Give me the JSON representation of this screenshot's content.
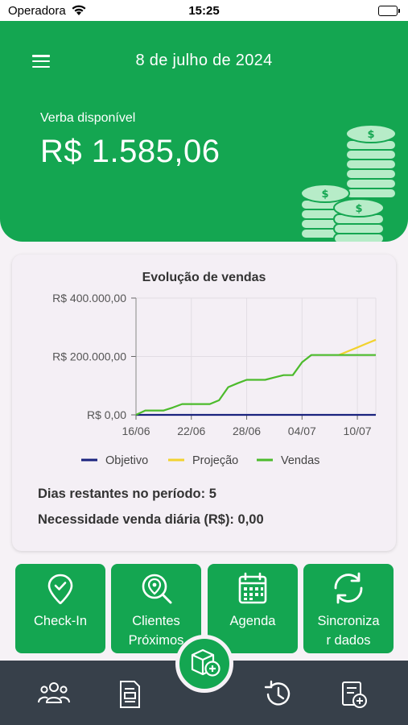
{
  "status_bar": {
    "carrier": "Operadora",
    "time": "15:25"
  },
  "header": {
    "date": "8 de julho de 2024",
    "budget_label": "Verba disponível",
    "budget_value": "R$ 1.585,06"
  },
  "card": {
    "chart_title": "Evolução de vendas",
    "stats": {
      "remaining_days": "Dias restantes no período: 5",
      "daily_need": "Necessidade venda diária (R$): 0,00"
    }
  },
  "chart_data": {
    "type": "line",
    "title": "Evolução de vendas",
    "x_ticks": [
      "16/06",
      "22/06",
      "28/06",
      "04/07",
      "10/07"
    ],
    "y_ticks": [
      "R$ 0,00",
      "R$ 200.000,00",
      "R$ 400.000,00"
    ],
    "ylim": [
      0,
      400000
    ],
    "x_days": [
      "16/06",
      "17/06",
      "18/06",
      "19/06",
      "20/06",
      "21/06",
      "22/06",
      "23/06",
      "24/06",
      "25/06",
      "26/06",
      "27/06",
      "28/06",
      "29/06",
      "30/06",
      "01/07",
      "02/07",
      "03/07",
      "04/07",
      "05/07",
      "06/07",
      "07/07",
      "08/07",
      "09/07",
      "10/07",
      "11/07",
      "12/07"
    ],
    "series": [
      {
        "name": "Objetivo",
        "color": "#1a237e",
        "values": [
          0,
          0,
          0,
          0,
          0,
          0,
          0,
          0,
          0,
          0,
          0,
          0,
          0,
          0,
          0,
          0,
          0,
          0,
          0,
          0,
          0,
          0,
          0,
          0,
          0,
          0,
          0,
          0
        ]
      },
      {
        "name": "Projeção",
        "color": "#f2d22e",
        "values": [
          null,
          null,
          null,
          null,
          null,
          null,
          null,
          null,
          null,
          null,
          null,
          null,
          null,
          null,
          null,
          null,
          null,
          null,
          null,
          null,
          null,
          null,
          205000,
          218000,
          231000,
          244000,
          257000,
          257000
        ]
      },
      {
        "name": "Vendas",
        "color": "#4cbb2c",
        "values": [
          0,
          15000,
          15000,
          15000,
          25000,
          37000,
          37000,
          37000,
          37000,
          50000,
          95000,
          108000,
          120000,
          120000,
          120000,
          128000,
          136000,
          136000,
          180000,
          205000,
          205000,
          205000,
          205000,
          205000,
          205000,
          205000,
          205000,
          205000
        ]
      }
    ],
    "legend_position": "bottom"
  },
  "actions": [
    {
      "label": "Check-In",
      "icon": "location-check-icon"
    },
    {
      "label": "Clientes Próximos",
      "icon": "search-location-icon"
    },
    {
      "label": "Agenda",
      "icon": "calendar-icon"
    },
    {
      "label": "Sincroniza r dados",
      "icon": "sync-icon"
    }
  ],
  "nav": [
    "users-icon",
    "document-icon",
    "new-order-icon",
    "history-icon",
    "add-list-icon"
  ],
  "colors": {
    "primary": "#14a651",
    "bottom_bar": "#37404a",
    "background": "#f6f2f6"
  }
}
